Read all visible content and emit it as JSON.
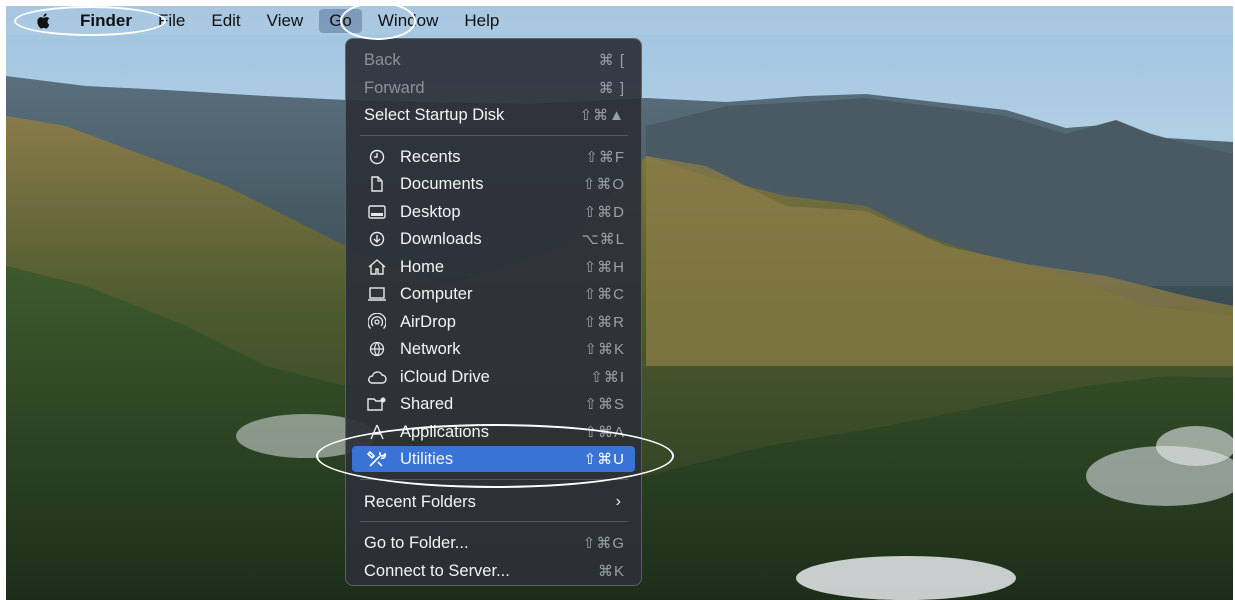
{
  "menubar": {
    "apple_icon": "apple-icon",
    "items": [
      "Finder",
      "File",
      "Edit",
      "View",
      "Go",
      "Window",
      "Help"
    ]
  },
  "go_menu": {
    "items": [
      {
        "label": "Back",
        "shortcut": "⌘ [",
        "enabled": false
      },
      {
        "label": "Forward",
        "shortcut": "⌘ ]",
        "enabled": false
      },
      {
        "label": "Select Startup Disk",
        "shortcut": "⇧⌘▲",
        "enabled": true
      },
      {
        "label": "Recents",
        "shortcut": "⇧⌘F",
        "icon": "clock-icon"
      },
      {
        "label": "Documents",
        "shortcut": "⇧⌘O",
        "icon": "document-icon"
      },
      {
        "label": "Desktop",
        "shortcut": "⇧⌘D",
        "icon": "desktop-icon"
      },
      {
        "label": "Downloads",
        "shortcut": "⌥⌘L",
        "icon": "download-icon"
      },
      {
        "label": "Home",
        "shortcut": "⇧⌘H",
        "icon": "home-icon"
      },
      {
        "label": "Computer",
        "shortcut": "⇧⌘C",
        "icon": "laptop-icon"
      },
      {
        "label": "AirDrop",
        "shortcut": "⇧⌘R",
        "icon": "airdrop-icon"
      },
      {
        "label": "Network",
        "shortcut": "⇧⌘K",
        "icon": "network-icon"
      },
      {
        "label": "iCloud Drive",
        "shortcut": "⇧⌘I",
        "icon": "cloud-icon"
      },
      {
        "label": "Shared",
        "shortcut": "⇧⌘S",
        "icon": "shared-folder-icon"
      },
      {
        "label": "Applications",
        "shortcut": "⇧⌘A",
        "icon": "applications-icon"
      },
      {
        "label": "Utilities",
        "shortcut": "⇧⌘U",
        "icon": "utilities-icon",
        "highlighted": true
      },
      {
        "label": "Recent Folders",
        "submenu": true
      },
      {
        "label": "Go to Folder...",
        "shortcut": "⇧⌘G"
      },
      {
        "label": "Connect to Server...",
        "shortcut": "⌘K"
      }
    ]
  },
  "colors": {
    "highlight": "#3a73d6",
    "menu_bg": "#2c3038",
    "annotation": "#ffffff"
  }
}
